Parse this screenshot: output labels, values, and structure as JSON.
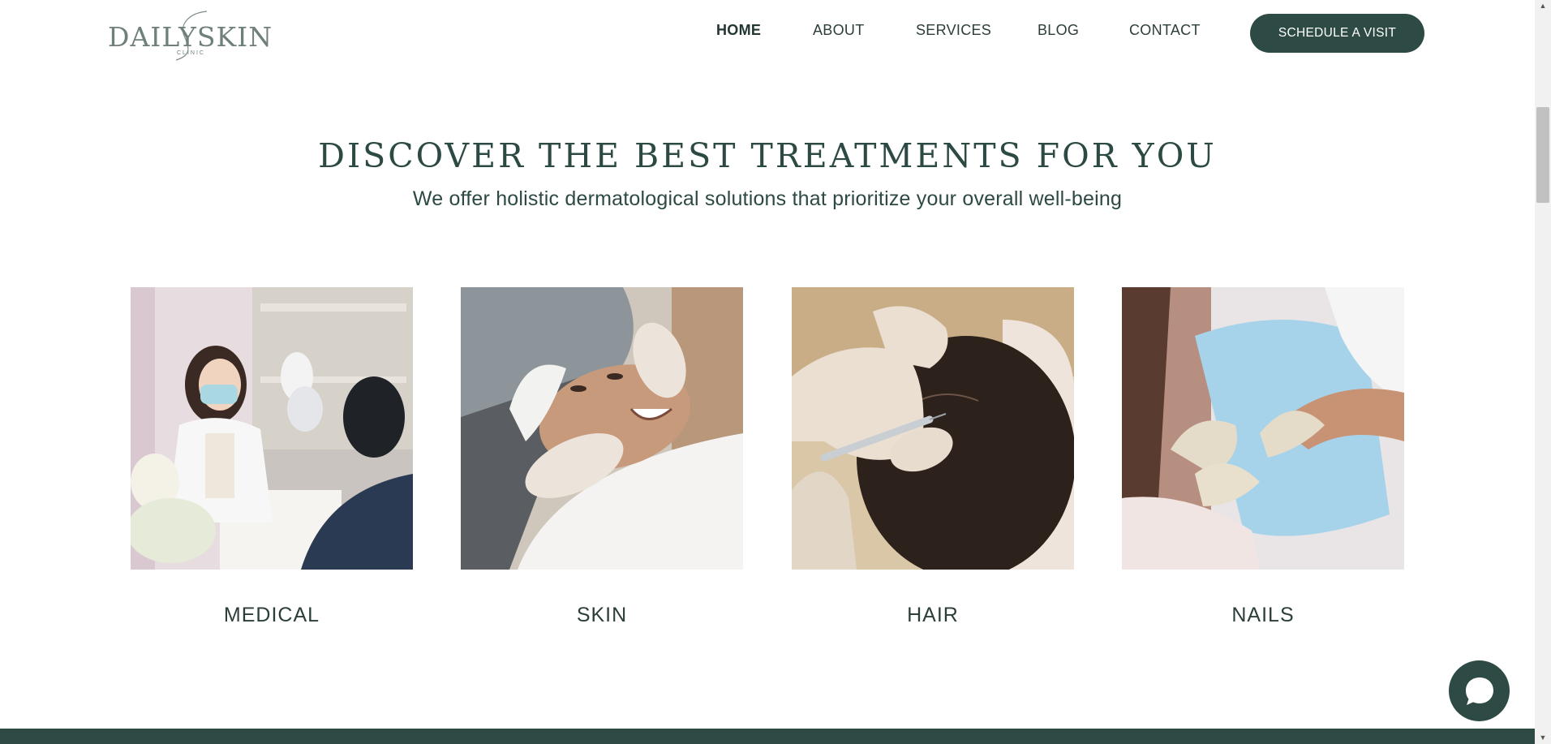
{
  "header": {
    "logo": {
      "text": "DAILYSKIN",
      "subtext": "CLINIC"
    },
    "nav": [
      {
        "label": "HOME",
        "active": true
      },
      {
        "label": "ABOUT",
        "active": false
      },
      {
        "label": "SERVICES",
        "active": false
      },
      {
        "label": "BLOG",
        "active": false
      },
      {
        "label": "CONTACT",
        "active": false
      }
    ],
    "cta_label": "SCHEDULE A VISIT"
  },
  "hero": {
    "title": "DISCOVER THE BEST TREATMENTS FOR YOU",
    "subtitle": "We offer holistic dermatological solutions that prioritize your overall well-being"
  },
  "services": [
    {
      "label": "MEDICAL",
      "image": "doctor-consultation-photo"
    },
    {
      "label": "SKIN",
      "image": "facial-treatment-photo"
    },
    {
      "label": "HAIR",
      "image": "scalp-injection-photo"
    },
    {
      "label": "NAILS",
      "image": "nail-treatment-photo"
    }
  ],
  "colors": {
    "brand": "#2e4a44",
    "text": "#2c4a43",
    "background": "#ffffff"
  },
  "icons": {
    "chat": "chat-bubble-icon"
  }
}
